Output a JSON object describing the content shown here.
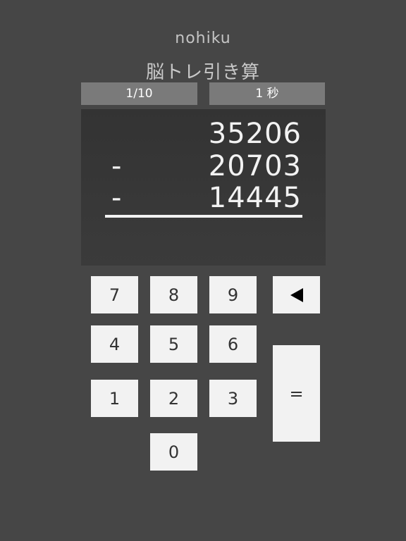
{
  "header": {
    "app_name": "nohiku",
    "subtitle": "脳トレ引き算"
  },
  "status": {
    "progress": "1/10",
    "timer": "1 秒"
  },
  "problem": {
    "rows": [
      {
        "operator": "",
        "value": "35206"
      },
      {
        "operator": "-",
        "value": "20703"
      },
      {
        "operator": "-",
        "value": "14445"
      }
    ]
  },
  "keypad": {
    "k7": "7",
    "k8": "8",
    "k9": "9",
    "k4": "4",
    "k5": "5",
    "k6": "6",
    "k1": "1",
    "k2": "2",
    "k3": "3",
    "k0": "0",
    "equals": "=",
    "backspace_icon": "left-triangle-icon"
  },
  "colors": {
    "background": "#464646",
    "status_box": "#7a7a7a",
    "panel": "#363636",
    "key": "#f2f2f2",
    "text_light": "#f2f2f2"
  }
}
